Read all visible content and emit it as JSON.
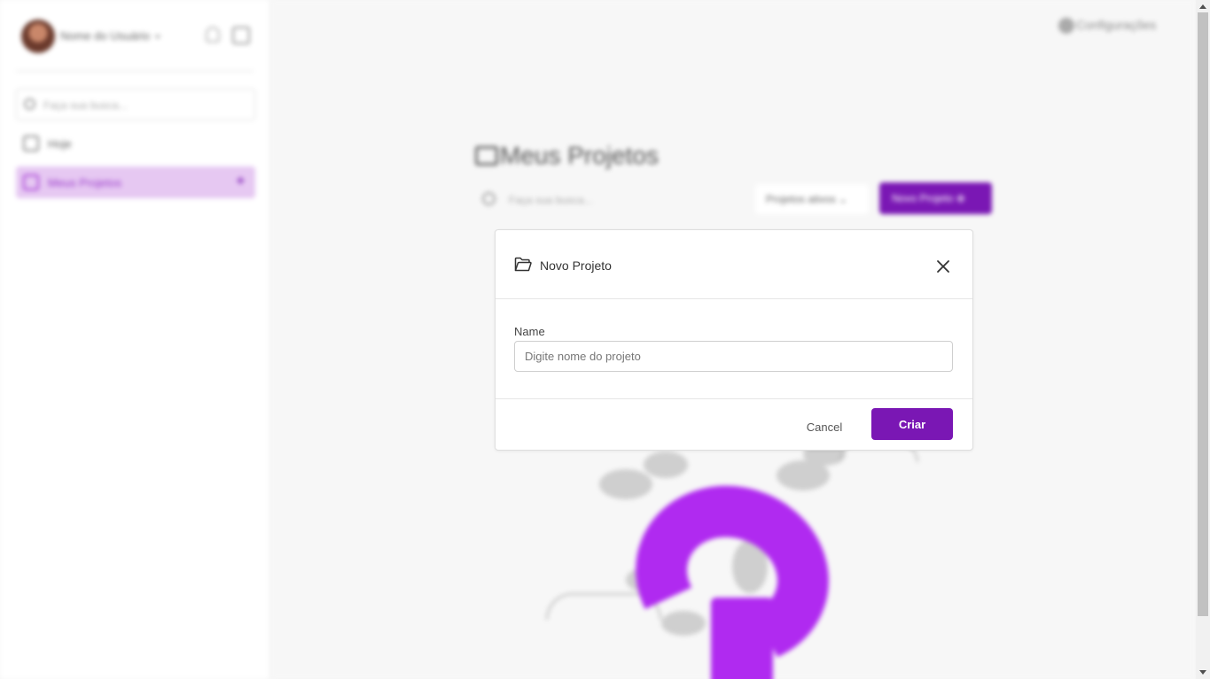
{
  "sidebar": {
    "user_name": "Nome do Usuário",
    "search_placeholder": "Faça sua busca...",
    "items": [
      {
        "label": "Hoje",
        "icon": "calendar-icon",
        "active": false
      },
      {
        "label": "Meus Projetos",
        "icon": "folder-icon",
        "active": true
      }
    ]
  },
  "header": {
    "config_label": "Configurações"
  },
  "main": {
    "title": "Meus Projetos",
    "search_placeholder": "Faça sua busca...",
    "filter_label": "Projetos ativos",
    "new_project_label": "Novo Projeto"
  },
  "modal": {
    "title": "Novo Projeto",
    "field_label": "Name",
    "field_placeholder": "Digite nome do projeto",
    "field_value": "",
    "cancel_label": "Cancel",
    "create_label": "Criar"
  },
  "colors": {
    "accent": "#7a17b4",
    "accent_light": "#e6c8f2",
    "illustration": "#b02af0"
  }
}
